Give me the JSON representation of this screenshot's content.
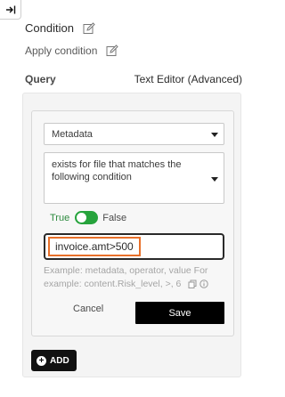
{
  "header": {
    "condition_title": "Condition",
    "apply_condition": "Apply condition"
  },
  "query": {
    "label": "Query",
    "editor_link": "Text Editor (Advanced)"
  },
  "condition_card": {
    "metadata_select": "Metadata",
    "condition_select": "exists for file that matches the following condition",
    "toggle_true": "True",
    "toggle_false": "False",
    "toggle_state": "on",
    "query_value": "invoice.amt>500",
    "hint": "Example: metadata, operator, value For example: content.Risk_level, >, 6",
    "cancel_label": "Cancel",
    "save_label": "Save"
  },
  "add_label": "ADD",
  "colors": {
    "toggle_on": "#26a33c",
    "focus_outline": "#e8702a",
    "primary_button": "#000000"
  },
  "icons": [
    "collapse-right-icon",
    "edit-icon",
    "copy-icon",
    "info-icon",
    "plus-circle-icon",
    "chevron-down-icon"
  ]
}
